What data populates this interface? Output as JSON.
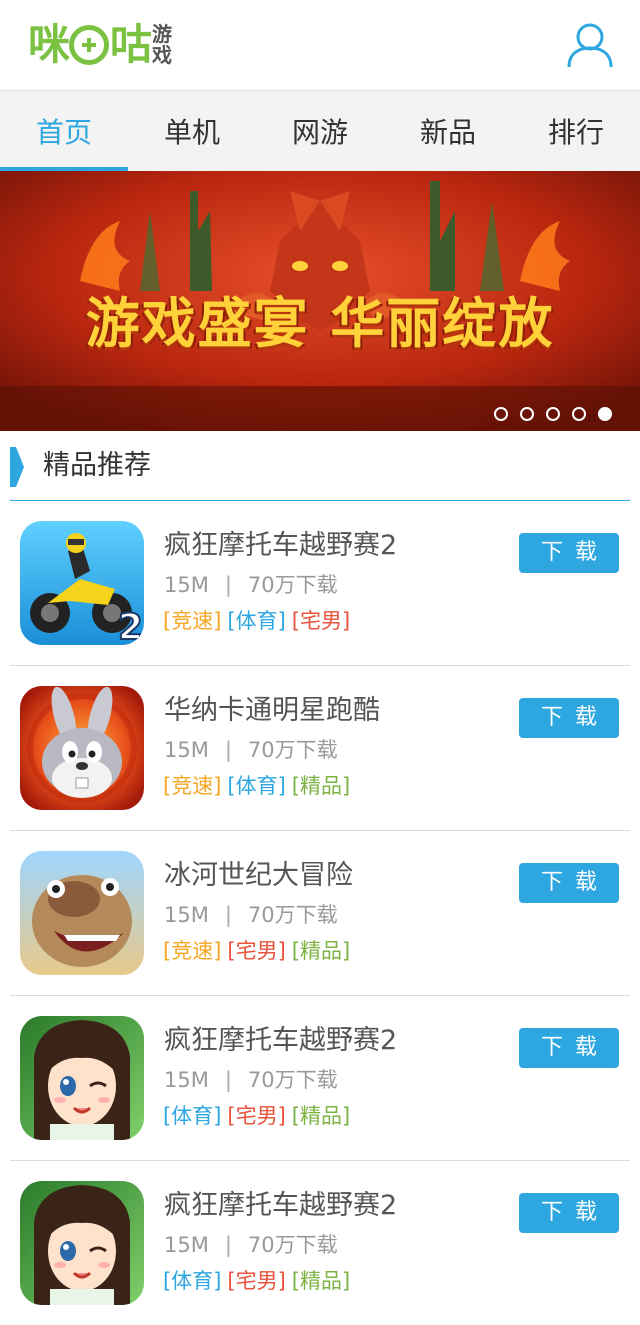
{
  "header": {
    "logo_text": "咪咕游戏",
    "logo_main_left": "咪",
    "logo_main_right": "咕",
    "logo_sub_top": "游",
    "logo_sub_bottom": "戏"
  },
  "nav": {
    "tabs": [
      {
        "label": "首页",
        "active": true
      },
      {
        "label": "单机",
        "active": false
      },
      {
        "label": "网游",
        "active": false
      },
      {
        "label": "新品",
        "active": false
      },
      {
        "label": "排行",
        "active": false
      }
    ]
  },
  "banner": {
    "title": "游戏盛宴 华丽绽放",
    "slide_count": 5,
    "active_slide": 5
  },
  "section": {
    "title": "精品推荐"
  },
  "games": [
    {
      "name": "疯狂摩托车越野赛2",
      "size": "15M",
      "separator": "|",
      "downloads": "70万下载",
      "tags": [
        {
          "text": "[竞速]",
          "color": "orange"
        },
        {
          "text": "[体育]",
          "color": "blue"
        },
        {
          "text": "[宅男]",
          "color": "red"
        }
      ],
      "button": "下载",
      "icon": "motocross-icon"
    },
    {
      "name": "华纳卡通明星跑酷",
      "size": "15M",
      "separator": "|",
      "downloads": "70万下载",
      "tags": [
        {
          "text": "[竞速]",
          "color": "orange"
        },
        {
          "text": "[体育]",
          "color": "blue"
        },
        {
          "text": "[精品]",
          "color": "green"
        }
      ],
      "button": "下载",
      "icon": "bunny-icon"
    },
    {
      "name": "冰河世纪大冒险",
      "size": "15M",
      "separator": "|",
      "downloads": "70万下载",
      "tags": [
        {
          "text": "[竞速]",
          "color": "orange"
        },
        {
          "text": "[宅男]",
          "color": "red"
        },
        {
          "text": "[精品]",
          "color": "green"
        }
      ],
      "button": "下载",
      "icon": "sloth-icon"
    },
    {
      "name": "疯狂摩托车越野赛2",
      "size": "15M",
      "separator": "|",
      "downloads": "70万下载",
      "tags": [
        {
          "text": "[体育]",
          "color": "blue"
        },
        {
          "text": "[宅男]",
          "color": "red"
        },
        {
          "text": "[精品]",
          "color": "green"
        }
      ],
      "button": "下载",
      "icon": "anime-girl-icon"
    },
    {
      "name": "疯狂摩托车越野赛2",
      "size": "15M",
      "separator": "|",
      "downloads": "70万下载",
      "tags": [
        {
          "text": "[体育]",
          "color": "blue"
        },
        {
          "text": "[宅男]",
          "color": "red"
        },
        {
          "text": "[精品]",
          "color": "green"
        }
      ],
      "button": "下载",
      "icon": "anime-girl-icon"
    }
  ],
  "colors": {
    "accent": "#2ea7e0",
    "brand_green": "#7cc242",
    "tag_orange": "#f5a623",
    "tag_red": "#e8543e",
    "tag_green": "#7cb342"
  }
}
